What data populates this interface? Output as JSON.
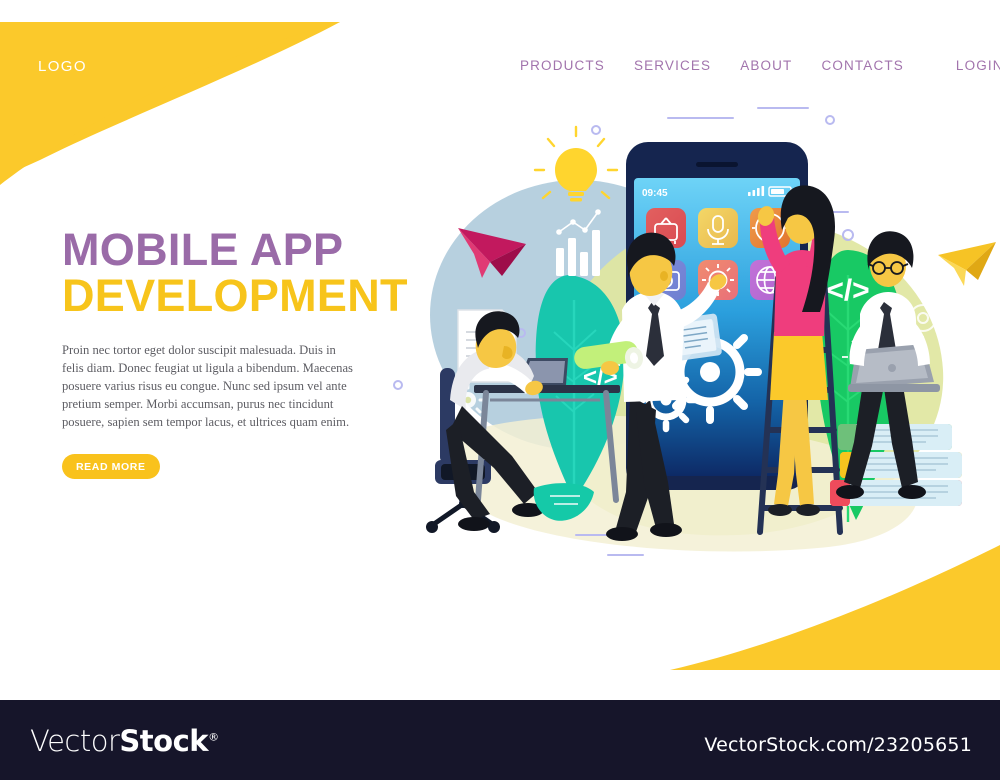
{
  "brand": {
    "logo_text": "LOGO",
    "logo_color": "#ffffff",
    "accent_yellow": "#f9c21c",
    "accent_purple": "#9a6ba8"
  },
  "nav": {
    "items": [
      {
        "label": "PRODUCTS",
        "name": "nav-products"
      },
      {
        "label": "SERVICES",
        "name": "nav-services"
      },
      {
        "label": "ABOUT",
        "name": "nav-about"
      },
      {
        "label": "CONTACTS",
        "name": "nav-contacts"
      },
      {
        "label": "LOGIN",
        "name": "nav-login"
      }
    ],
    "color": "#a274ad"
  },
  "hero": {
    "heading_line1": "MOBILE APP",
    "heading_line2": "DEVELOPMENT",
    "heading_line1_color": "#9a6ba8",
    "heading_line2_color": "#f7c41b",
    "paragraph": "Proin nec tortor eget dolor suscipit malesuada. Duis in felis diam. Donec feugiat ut ligula a bibendum. Maecenas posuere varius risus eu congue. Nunc sed ipsum vel ante pretium semper. Morbi accumsan, purus nec tincidunt posuere, sapien sem tempor lacus, et ultrices quam enim.",
    "cta_label": "READ MORE",
    "cta_bg": "#f9c21c",
    "cta_text_color": "#ffffff"
  },
  "illustration": {
    "phone": {
      "status_time": "09:45",
      "signal_icon": "signal-bars-icon",
      "battery_icon": "battery-icon",
      "screen_top_color": "#63cdf6",
      "screen_bottom_color": "#0d2a66",
      "body_color": "#15254f",
      "app_icons": [
        {
          "name": "tv-icon",
          "label": "TV",
          "color": "#e05a5a"
        },
        {
          "name": "microphone-icon",
          "label": "Microphone",
          "color": "#f2d25c"
        },
        {
          "name": "clock-icon",
          "label": "Clock",
          "color": "#e8913c"
        },
        {
          "name": "camera-icon",
          "label": "Camera",
          "color": "#7b7fd6"
        },
        {
          "name": "gear-icon",
          "label": "Settings",
          "color": "#ef7e6b"
        },
        {
          "name": "globe-icon",
          "label": "Browser",
          "color": "#c46fd2"
        }
      ]
    },
    "characters": [
      {
        "name": "seated-developer",
        "description": "man at desk with laptop on office chair"
      },
      {
        "name": "standing-manager",
        "description": "man holding blueprint roll beside gears"
      },
      {
        "name": "woman-on-ladder",
        "description": "woman in pink top and yellow skirt touching phone screen"
      },
      {
        "name": "developer-on-books",
        "description": "man with glasses on stack of books with laptop"
      }
    ],
    "decor_icons": [
      {
        "name": "lightbulb-icon",
        "color": "#ffd52e"
      },
      {
        "name": "paper-plane-pink-icon",
        "color": "#c2195e"
      },
      {
        "name": "paper-plane-yellow-icon",
        "color": "#f6c325"
      },
      {
        "name": "bar-chart-icon",
        "color": "#ffffff"
      },
      {
        "name": "document-icon",
        "color": "#ffffff"
      },
      {
        "name": "code-brackets-icon",
        "label": "</>",
        "color": "#ffffff"
      },
      {
        "name": "gear-outline-icon",
        "color": "#ffffff"
      },
      {
        "name": "lightbulb-outline-icon",
        "color": "#ffffff"
      },
      {
        "name": "leaf-teal-icon",
        "color": "#1ec8b0"
      },
      {
        "name": "leaf-green-icon",
        "color": "#18c964"
      }
    ],
    "blob_colors": {
      "light_blue": "#b5cfe0",
      "pale_green": "#dde59a",
      "cream": "#f2efd2"
    }
  },
  "footer": {
    "logo_thin": "Vector",
    "logo_bold": "Stock",
    "logo_registered": "®",
    "url": "VectorStock.com/23205651",
    "bg": "#16152a"
  }
}
